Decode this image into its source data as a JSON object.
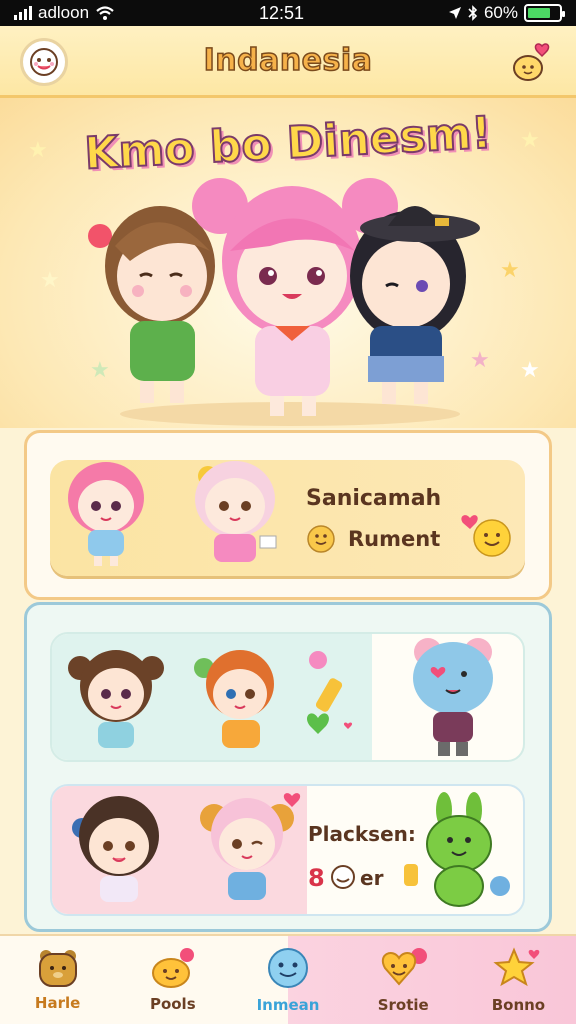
{
  "status_bar": {
    "carrier": "adloon",
    "time": "12:51",
    "battery": "60%"
  },
  "header": {
    "title": "Indanesia",
    "left_icon": "mascot-face-icon",
    "right_icon": "heart-mascot-icon"
  },
  "hero": {
    "banner": "Kmo bo Dinesm!"
  },
  "panel1": {
    "card": {
      "title": "Sanicamah",
      "subtitle": "Rument"
    }
  },
  "panel2": {
    "card3": {
      "title": "Placksen:",
      "number": "8",
      "suffix": "er"
    }
  },
  "nav": {
    "items": [
      {
        "label": "Harle",
        "icon": "bear-icon",
        "active": false
      },
      {
        "label": "Pools",
        "icon": "blob-balloon-icon",
        "active": false
      },
      {
        "label": "Inmean",
        "icon": "blue-smile-icon",
        "active": true
      },
      {
        "label": "Srotie",
        "icon": "heart-smile-icon",
        "active": false
      },
      {
        "label": "Bonno",
        "icon": "star-icon",
        "active": false
      }
    ]
  },
  "colors": {
    "accent_yellow": "#f6b24a",
    "accent_pink": "#f08fb6",
    "accent_blue": "#3aa3d8",
    "text_brown": "#5a3520"
  }
}
